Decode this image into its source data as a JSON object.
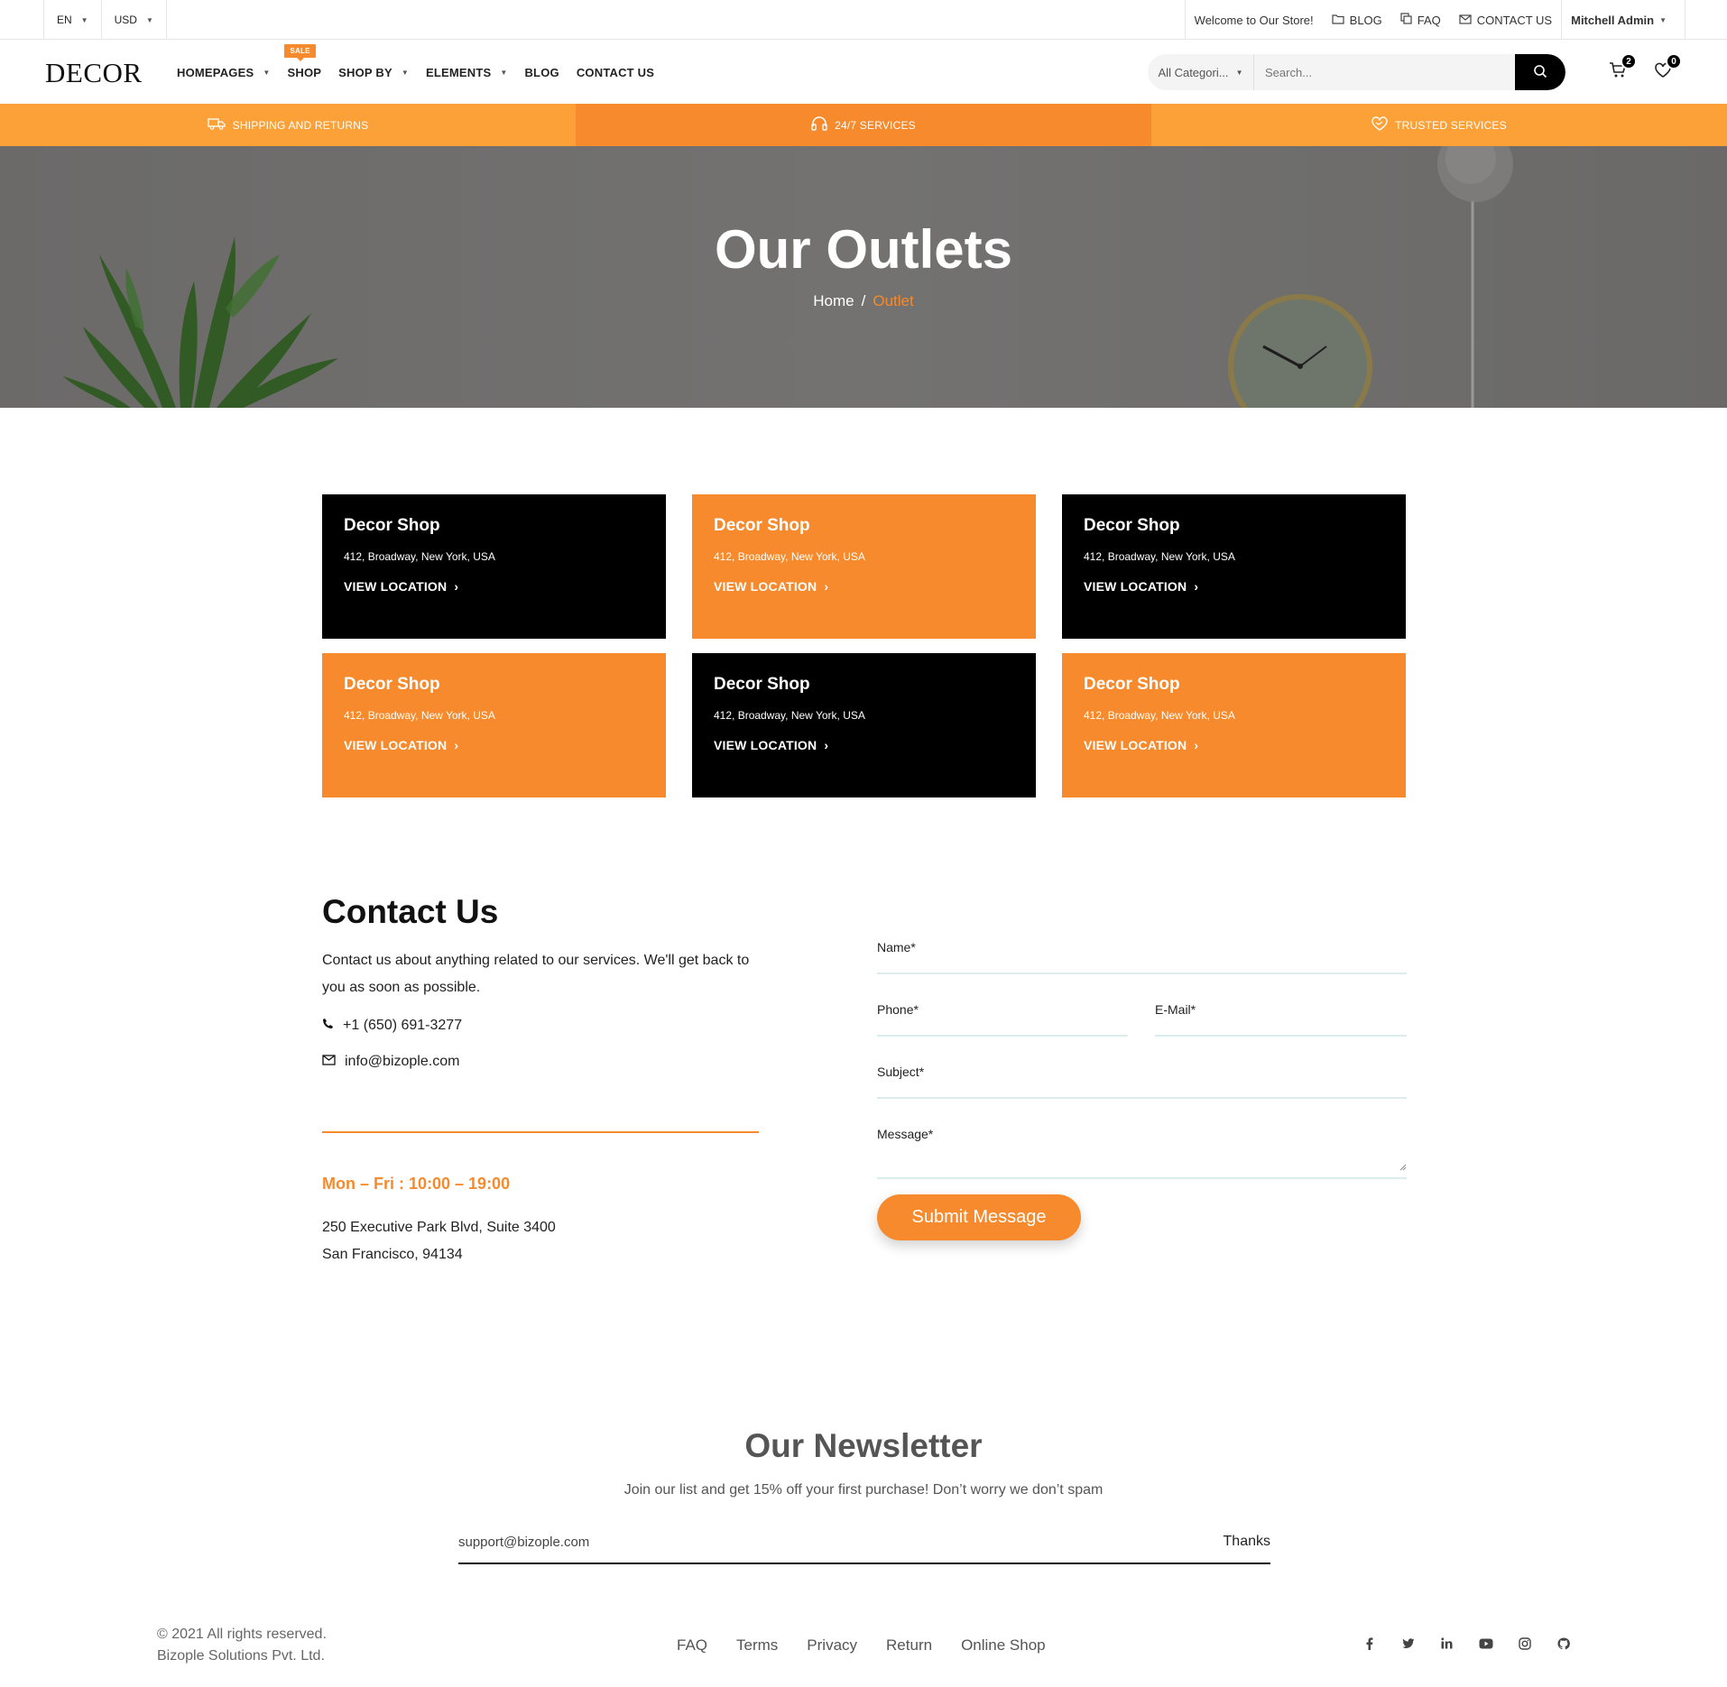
{
  "topbar": {
    "language": "EN",
    "currency": "USD",
    "welcome": "Welcome to Our Store!",
    "links": {
      "blog": "BLOG",
      "faq": "FAQ",
      "contact": "CONTACT US"
    },
    "user": "Mitchell Admin"
  },
  "header": {
    "logo": "DECOR",
    "nav": {
      "homepages": "HOMEPAGES",
      "shop": "SHOP",
      "sale_badge": "SALE",
      "shop_by": "SHOP BY",
      "elements": "ELEMENTS",
      "blog": "BLOG",
      "contact": "CONTACT US"
    },
    "search": {
      "category": "All Categori...",
      "placeholder": "Search..."
    },
    "cart_count": "2",
    "wishlist_count": "0"
  },
  "services": {
    "shipping": "SHIPPING AND RETURNS",
    "support": "24/7 SERVICES",
    "trusted": "TRUSTED SERVICES"
  },
  "hero": {
    "title": "Our Outlets",
    "breadcrumb_home": "Home",
    "breadcrumb_sep": "/",
    "breadcrumb_current": "Outlet"
  },
  "outlets": [
    {
      "name": "Decor Shop",
      "address": "412, Broadway, New York, USA",
      "link": "VIEW LOCATION",
      "style": "black"
    },
    {
      "name": "Decor Shop",
      "address": "412, Broadway, New York, USA",
      "link": "VIEW LOCATION",
      "style": "orange"
    },
    {
      "name": "Decor Shop",
      "address": "412, Broadway, New York, USA",
      "link": "VIEW LOCATION",
      "style": "black"
    },
    {
      "name": "Decor Shop",
      "address": "412, Broadway, New York, USA",
      "link": "VIEW LOCATION",
      "style": "orange"
    },
    {
      "name": "Decor Shop",
      "address": "412, Broadway, New York, USA",
      "link": "VIEW LOCATION",
      "style": "black"
    },
    {
      "name": "Decor Shop",
      "address": "412, Broadway, New York, USA",
      "link": "VIEW LOCATION",
      "style": "orange"
    }
  ],
  "contact": {
    "title": "Contact Us",
    "description": "Contact us about anything related to our services. We'll get back to you as soon as possible.",
    "phone": "+1 (650) 691-3277",
    "email": "info@bizople.com",
    "hours": "Mon – Fri : 10:00 – 19:00",
    "address_line1": "250 Executive Park Blvd, Suite 3400",
    "address_line2": "San Francisco, 94134"
  },
  "form": {
    "name_label": "Name*",
    "phone_label": "Phone*",
    "email_label": "E-Mail*",
    "subject_label": "Subject*",
    "message_label": "Message*",
    "submit": "Submit Message"
  },
  "newsletter": {
    "title": "Our Newsletter",
    "subtitle": "Join our list and get 15% off your first purchase! Don’t worry we don’t spam",
    "input_value": "support@bizople.com",
    "button": "Thanks"
  },
  "footer": {
    "copyright": "© 2021 All rights reserved.",
    "company": "Bizople Solutions Pvt. Ltd.",
    "links": [
      "FAQ",
      "Terms",
      "Privacy",
      "Return",
      "Online Shop"
    ]
  },
  "colors": {
    "accent": "#f68a2c",
    "accent_light": "#fba137",
    "dark": "#000000",
    "hero_bg": "#6f6e6d"
  }
}
